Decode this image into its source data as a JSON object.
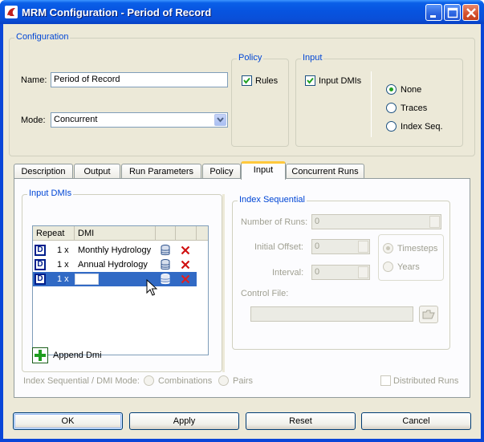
{
  "window": {
    "title": "MRM Configuration - Period of Record",
    "app_icon": "riverware-logo-icon",
    "controls": [
      "minimize-icon",
      "maximize-icon",
      "close-icon"
    ]
  },
  "configuration": {
    "group_title": "Configuration",
    "name_label": "Name:",
    "name_value": "Period of Record",
    "mode_label": "Mode:",
    "mode_value": "Concurrent",
    "policy": {
      "group_title": "Policy",
      "rules_label": "Rules",
      "rules_checked": true
    },
    "input": {
      "group_title": "Input",
      "input_dmis_label": "Input DMIs",
      "input_dmis_checked": true,
      "options": [
        {
          "label": "None",
          "selected": true
        },
        {
          "label": "Traces",
          "selected": false
        },
        {
          "label": "Index Seq.",
          "selected": false
        }
      ]
    }
  },
  "tabs": [
    {
      "label": "Description",
      "active": false
    },
    {
      "label": "Output",
      "active": false
    },
    {
      "label": "Run Parameters",
      "active": false
    },
    {
      "label": "Policy",
      "active": false
    },
    {
      "label": "Input",
      "active": true
    },
    {
      "label": "Concurrent Runs",
      "active": false
    }
  ],
  "input_tab": {
    "input_dmis": {
      "group_title": "Input DMIs",
      "columns": [
        "Repeat",
        "DMI",
        "",
        ""
      ],
      "rows": [
        {
          "badge": "D",
          "repeat": "1 x",
          "dmi": "Monthly Hydrology",
          "selected": false
        },
        {
          "badge": "D",
          "repeat": "1 x",
          "dmi": "Annual Hydrology",
          "selected": false
        },
        {
          "badge": "D",
          "repeat": "1 x",
          "dmi": "",
          "selected": true
        }
      ],
      "row_icons": [
        "database-icon",
        "delete-x-icon"
      ],
      "append_label": "Append Dmi",
      "append_icon": "green-plus-icon"
    },
    "index_sequential": {
      "group_title": "Index Sequential",
      "number_of_runs_label": "Number of Runs:",
      "number_of_runs_value": "0",
      "initial_offset_label": "Initial Offset:",
      "initial_offset_value": "0",
      "interval_label": "Interval:",
      "interval_value": "0",
      "unit_options": [
        {
          "label": "Timesteps",
          "selected": true
        },
        {
          "label": "Years",
          "selected": false
        }
      ],
      "control_file_label": "Control File:",
      "control_file_value": "",
      "browse_icon": "folder-open-icon"
    },
    "mode_row": {
      "label": "Index Sequential / DMI Mode:",
      "options": [
        {
          "label": "Combinations",
          "selected": false
        },
        {
          "label": "Pairs",
          "selected": false
        }
      ],
      "distributed_runs_label": "Distributed Runs",
      "distributed_runs_checked": false
    }
  },
  "buttons": {
    "ok": "OK",
    "apply": "Apply",
    "reset": "Reset",
    "cancel": "Cancel"
  }
}
